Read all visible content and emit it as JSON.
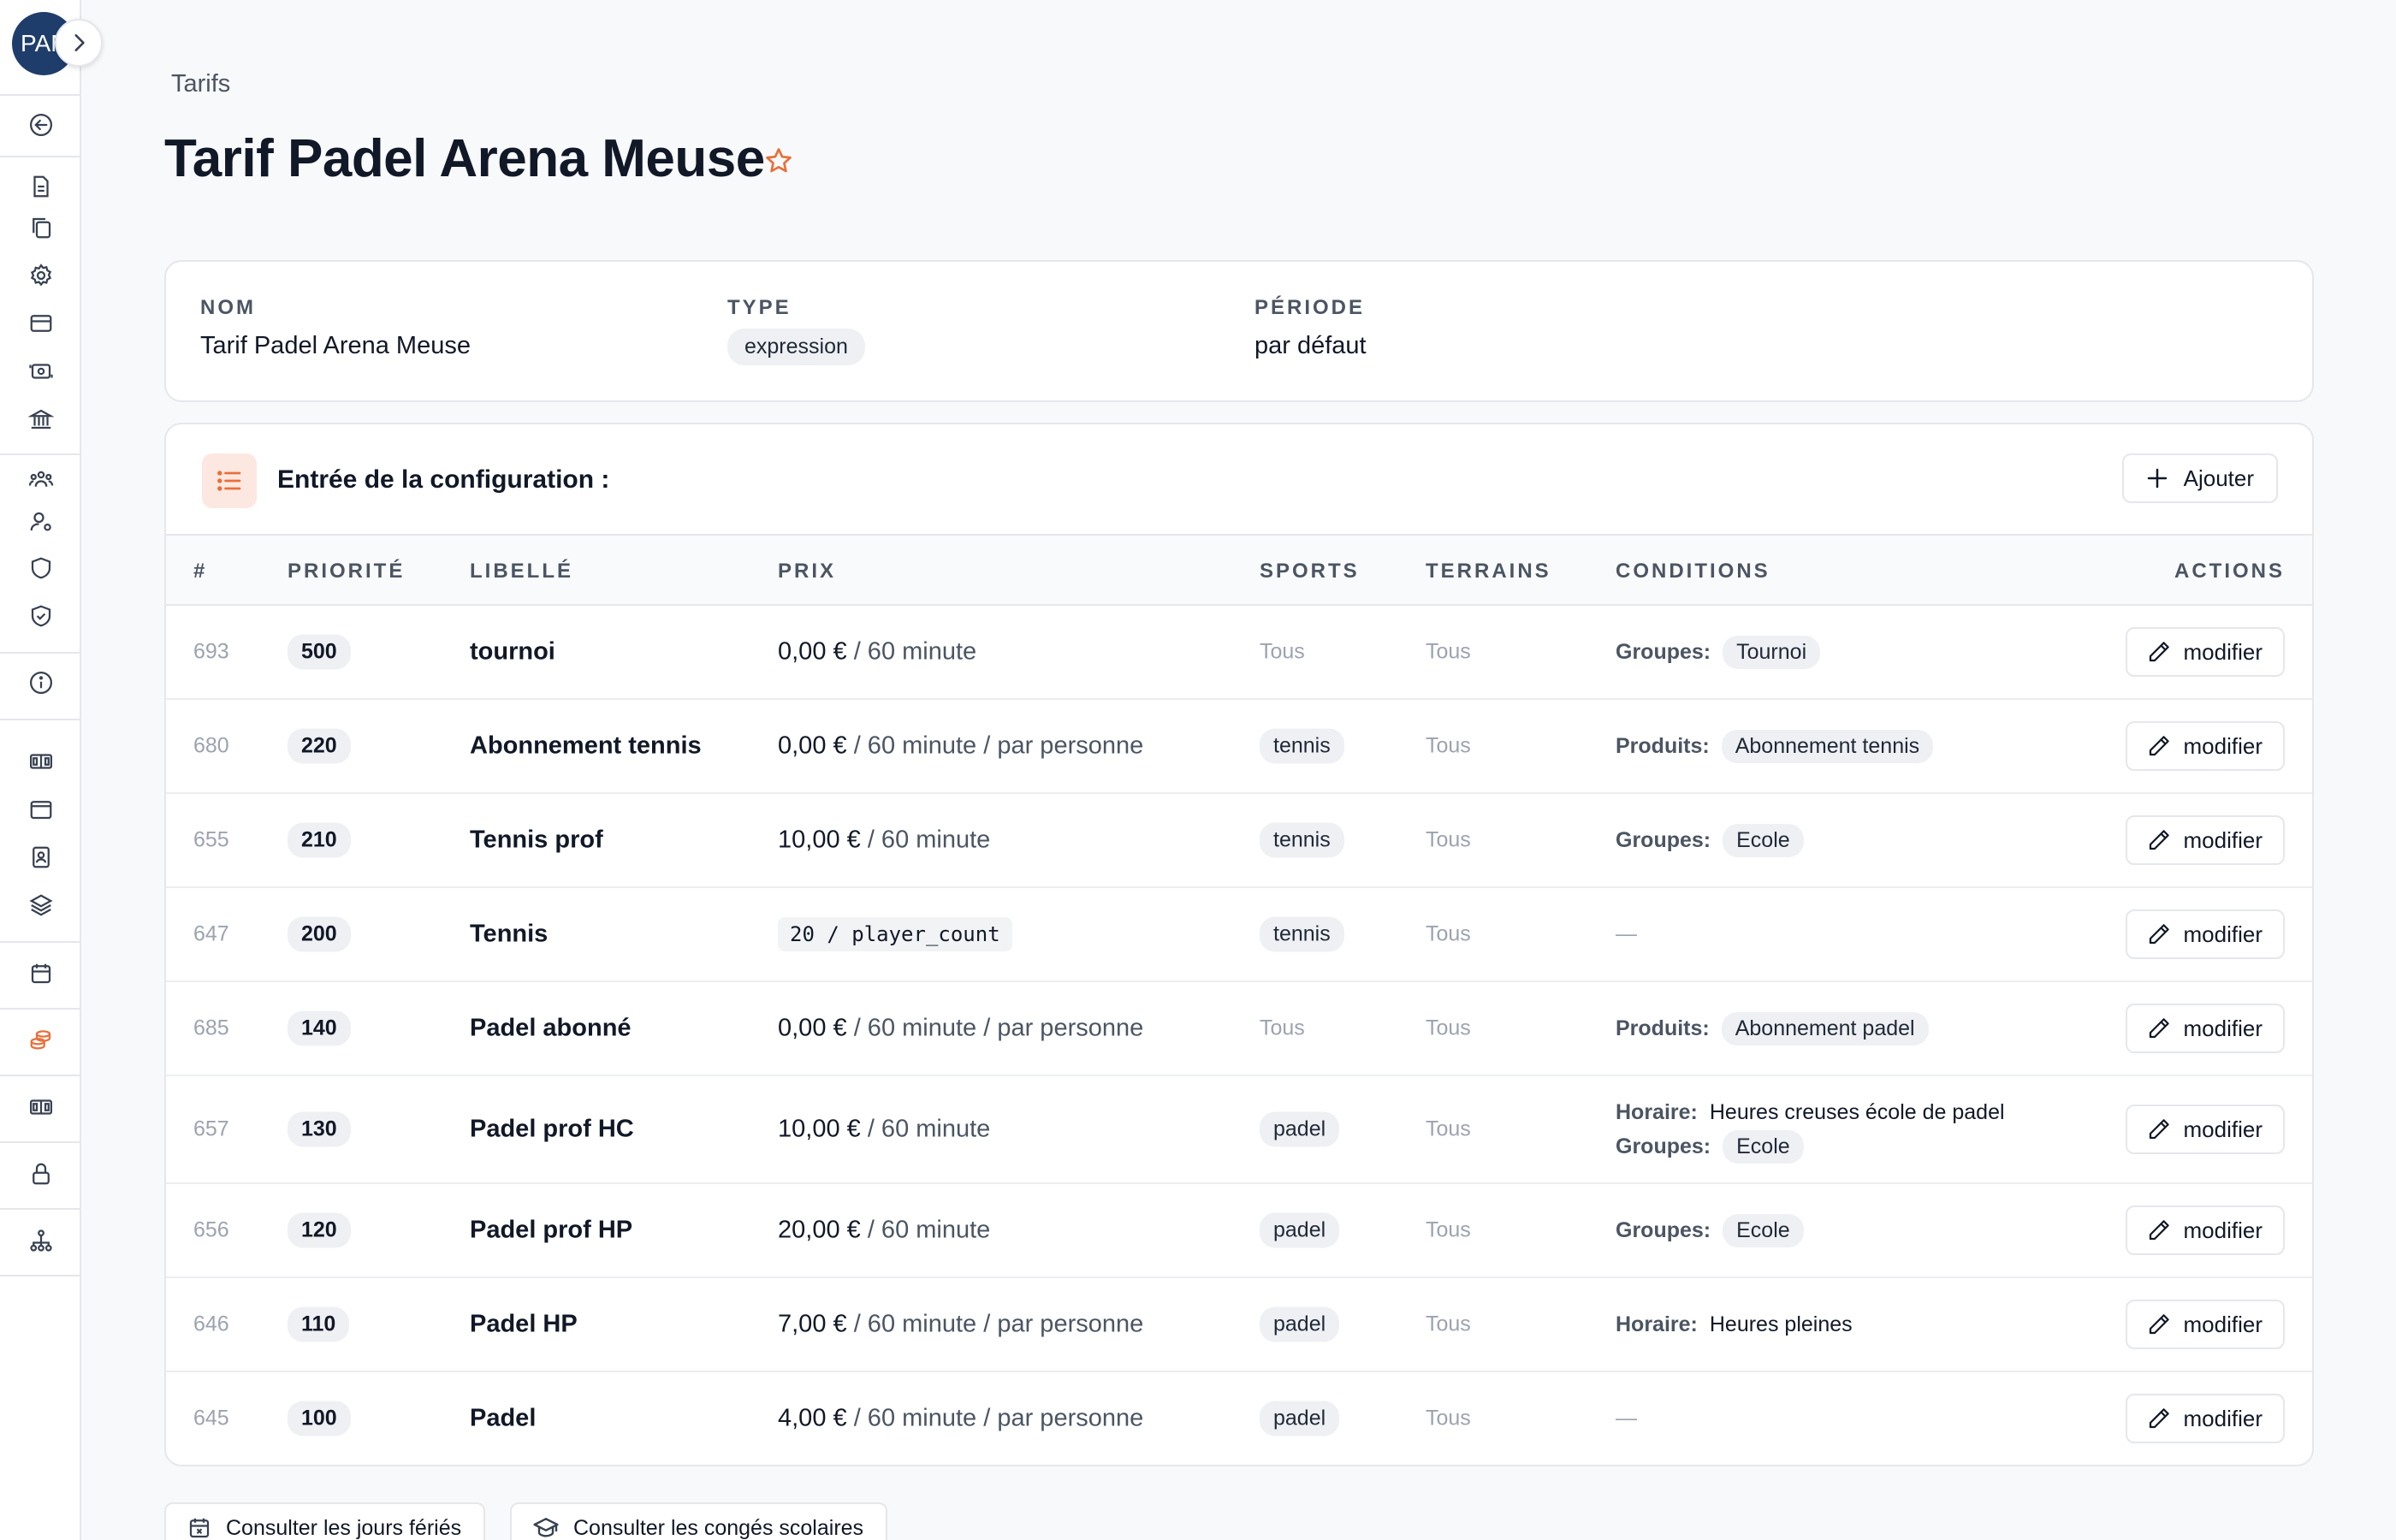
{
  "user": {
    "initials": "PAM"
  },
  "sidebar": {
    "icons": [
      "arrow-left-circle-icon",
      "file-icon",
      "copy-icon",
      "gear-icon",
      "credit-card-icon",
      "cash-icon",
      "bank-icon",
      "users-icon",
      "user-gear-icon",
      "shield-icon",
      "shield-check-icon",
      "info-icon",
      "court-icon",
      "wallet-icon",
      "badge-icon",
      "layers-icon",
      "calendar-icon",
      "coins-icon",
      "court-icon-2",
      "lock-icon",
      "hierarchy-icon"
    ],
    "active_color": "#e8703a"
  },
  "breadcrumb": "Tarifs",
  "page_title": "Tarif Padel Arena Meuse",
  "info": {
    "name_label": "NOM",
    "name_value": "Tarif Padel Arena Meuse",
    "type_label": "TYPE",
    "type_value": "expression",
    "period_label": "PÉRIODE",
    "period_value": "par défaut"
  },
  "config": {
    "title": "Entrée de la configuration :",
    "add_label": "Ajouter",
    "columns": {
      "id": "#",
      "priority": "PRIORITÉ",
      "label": "LIBELLÉ",
      "price": "PRIX",
      "sports": "SPORTS",
      "terrains": "TERRAINS",
      "conditions": "CONDITIONS",
      "actions": "ACTIONS"
    },
    "rows": [
      {
        "id": "693",
        "priority": "500",
        "label": "tournoi",
        "amount": "0,00 €",
        "unit": " / 60 minute",
        "sports": "Tous",
        "sports_pill": false,
        "terrains": "Tous",
        "conditions": [
          {
            "key": "Groupes:",
            "value": "Tournoi",
            "pill": true
          }
        ],
        "action": "modifier"
      },
      {
        "id": "680",
        "priority": "220",
        "label": "Abonnement tennis",
        "amount": "0,00 €",
        "unit": " / 60 minute / par personne",
        "sports": "tennis",
        "sports_pill": true,
        "terrains": "Tous",
        "conditions": [
          {
            "key": "Produits:",
            "value": "Abonnement tennis",
            "pill": true
          }
        ],
        "action": "modifier"
      },
      {
        "id": "655",
        "priority": "210",
        "label": "Tennis prof",
        "amount": "10,00 €",
        "unit": " / 60 minute",
        "sports": "tennis",
        "sports_pill": true,
        "terrains": "Tous",
        "conditions": [
          {
            "key": "Groupes:",
            "value": "Ecole",
            "pill": true
          }
        ],
        "action": "modifier"
      },
      {
        "id": "647",
        "priority": "200",
        "label": "Tennis",
        "code": "20 / player_count",
        "sports": "tennis",
        "sports_pill": true,
        "terrains": "Tous",
        "conditions": [],
        "dash": "—",
        "action": "modifier"
      },
      {
        "id": "685",
        "priority": "140",
        "label": "Padel abonné",
        "amount": "0,00 €",
        "unit": " / 60 minute / par personne",
        "sports": "Tous",
        "sports_pill": false,
        "terrains": "Tous",
        "conditions": [
          {
            "key": "Produits:",
            "value": "Abonnement padel",
            "pill": true
          }
        ],
        "action": "modifier"
      },
      {
        "id": "657",
        "priority": "130",
        "label": "Padel prof HC",
        "amount": "10,00 €",
        "unit": " / 60 minute",
        "sports": "padel",
        "sports_pill": true,
        "terrains": "Tous",
        "conditions": [
          {
            "key": "Horaire:",
            "value": "Heures creuses école de padel",
            "pill": false
          },
          {
            "key": "Groupes:",
            "value": "Ecole",
            "pill": true
          }
        ],
        "action": "modifier"
      },
      {
        "id": "656",
        "priority": "120",
        "label": "Padel prof HP",
        "amount": "20,00 €",
        "unit": " / 60 minute",
        "sports": "padel",
        "sports_pill": true,
        "terrains": "Tous",
        "conditions": [
          {
            "key": "Groupes:",
            "value": "Ecole",
            "pill": true
          }
        ],
        "action": "modifier"
      },
      {
        "id": "646",
        "priority": "110",
        "label": "Padel HP",
        "amount": "7,00 €",
        "unit": " / 60 minute / par personne",
        "sports": "padel",
        "sports_pill": true,
        "terrains": "Tous",
        "conditions": [
          {
            "key": "Horaire:",
            "value": "Heures pleines",
            "pill": false
          }
        ],
        "action": "modifier"
      },
      {
        "id": "645",
        "priority": "100",
        "label": "Padel",
        "amount": "4,00 €",
        "unit": " / 60 minute / par personne",
        "sports": "padel",
        "sports_pill": true,
        "terrains": "Tous",
        "conditions": [],
        "dash": "—",
        "action": "modifier"
      }
    ]
  },
  "footer": {
    "holidays_label": "Consulter les jours fériés",
    "school_label": "Consulter les congés scolaires"
  }
}
